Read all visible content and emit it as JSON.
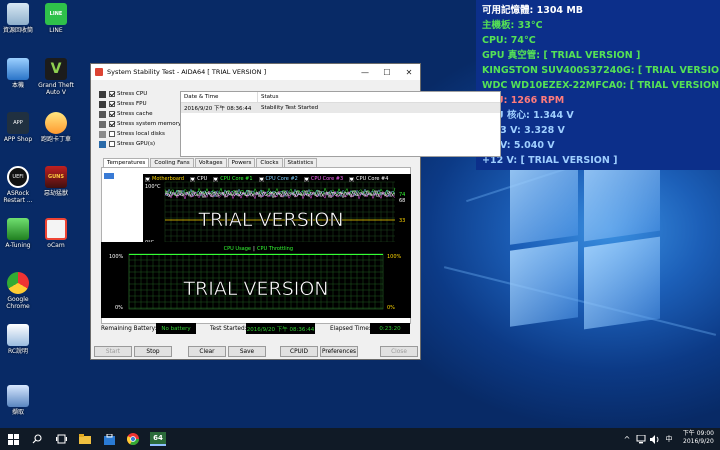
{
  "desktop_icons": [
    {
      "label": "資源回收筒"
    },
    {
      "label": "LINE"
    },
    {
      "label": "本機"
    },
    {
      "label": "Grand Theft Auto V"
    },
    {
      "label": "APP Shop"
    },
    {
      "label": "跑跑卡丁車"
    },
    {
      "label": "ASRock Restart ..."
    },
    {
      "label": "惡劫猛獸"
    },
    {
      "label": "A-Tuning"
    },
    {
      "label": "oCam"
    },
    {
      "label": "Google Chrome"
    },
    {
      "label": "RC說明"
    },
    {
      "label": "擷取"
    }
  ],
  "sensor": {
    "rows": [
      {
        "text": "可用記憶體: 1304 MB",
        "color": "#ffffff"
      },
      {
        "text": "主機板: 33°C",
        "color": "#55e255"
      },
      {
        "text": "CPU: 74°C",
        "color": "#55e255"
      },
      {
        "text": "GPU 真空管: [ TRIAL VERSION ]",
        "color": "#55e255"
      },
      {
        "text": "KINGSTON SUV400S37240G: [ TRIAL VERSION ]",
        "color": "#55e255"
      },
      {
        "text": "WDC WD10EZEX-22MFCA0: [ TRIAL VERSION ]",
        "color": "#55e255"
      },
      {
        "text": "CPU: 1266 RPM",
        "color": "#ff7b7b"
      },
      {
        "text": "CPU 核心: 1.344 V",
        "color": "#9fcfff"
      },
      {
        "text": "+3.3 V: 3.328 V",
        "color": "#9fcfff"
      },
      {
        "text": "+5 V: 5.040 V",
        "color": "#9fcfff"
      },
      {
        "text": "+12 V: [ TRIAL VERSION ]",
        "color": "#9fcfff"
      }
    ]
  },
  "window": {
    "title": "System Stability Test - AIDA64  [ TRIAL VERSION ]",
    "stress_items": [
      {
        "label": "Stress CPU",
        "checked": true
      },
      {
        "label": "Stress FPU",
        "checked": true
      },
      {
        "label": "Stress cache",
        "checked": true
      },
      {
        "label": "Stress system memory",
        "checked": true
      },
      {
        "label": "Stress local disks",
        "checked": false
      },
      {
        "label": "Stress GPU(s)",
        "checked": false
      }
    ],
    "log": {
      "col_date": "Date & Time",
      "col_status": "Status",
      "rows": [
        {
          "date": "2016/9/20 下午 08:36:44",
          "status": "Stability Test Started"
        }
      ]
    },
    "tabs": [
      "Temperatures",
      "Cooling Fans",
      "Voltages",
      "Powers",
      "Clocks",
      "Statistics"
    ],
    "temp_chart": {
      "legend": [
        {
          "label": "Motherboard",
          "color": "#ffd700"
        },
        {
          "label": "CPU",
          "color": "#ffffff"
        },
        {
          "label": "CPU Core #1",
          "color": "#33ff33"
        },
        {
          "label": "CPU Core #2",
          "color": "#7fd0ff"
        },
        {
          "label": "CPU Core #3",
          "color": "#ff66ff"
        },
        {
          "label": "CPU Core #4",
          "color": "#ffffff"
        }
      ],
      "y_top": "100°C",
      "y_bottom": "0°C",
      "right_labels": [
        "74",
        "68",
        "33"
      ],
      "watermark": "TRIAL VERSION"
    },
    "usage_chart": {
      "title_usage": "CPU Usage",
      "title_sep": "|",
      "title_throttle": "CPU Throttling",
      "y_top_left": "100%",
      "y_bottom_left": "0%",
      "y_top_right": "100%",
      "y_bottom_right": "0%",
      "watermark": "TRIAL VERSION"
    },
    "status": {
      "battery_label": "Remaining Battery:",
      "battery_value": "No battery",
      "started_label": "Test Started:",
      "started_value": "2016/9/20 下午 08:36:44",
      "elapsed_label": "Elapsed Time:",
      "elapsed_value": "0:23:20"
    },
    "buttons": {
      "start": "Start",
      "stop": "Stop",
      "clear": "Clear",
      "save": "Save",
      "cpuid": "CPUID",
      "preferences": "Preferences",
      "close": "Close"
    }
  },
  "taskbar": {
    "time": "下午 09:00",
    "date": "2016/9/20",
    "aida_label": "64"
  }
}
